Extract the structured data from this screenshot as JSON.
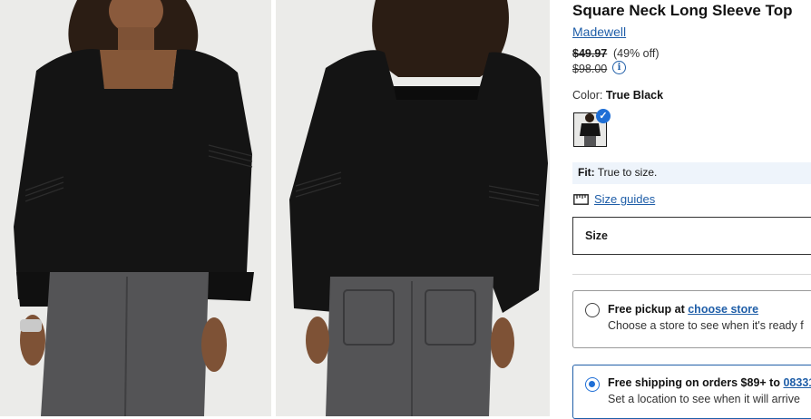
{
  "product": {
    "title": "Square Neck Long Sleeve Top",
    "brand": "Madewell",
    "sale_price": "$49.97",
    "discount": "(49% off)",
    "original_price": "$98.00"
  },
  "color": {
    "label": "Color:",
    "value": "True Black"
  },
  "fit": {
    "label": "Fit:",
    "value": "True to size."
  },
  "size_guides_label": "Size guides",
  "size_label": "Size",
  "pickup": {
    "title_prefix": "Free pickup at",
    "link": "choose store",
    "subtitle": "Choose a store to see when it's ready f"
  },
  "shipping": {
    "title_prefix": "Free shipping on orders $89+ to",
    "link": "08331",
    "subtitle": "Set a location to see when it will arrive"
  },
  "colors": {
    "link": "#1f5ea8",
    "selected": "#1f6fd6",
    "garment": "#141414",
    "denim": "#545456"
  }
}
